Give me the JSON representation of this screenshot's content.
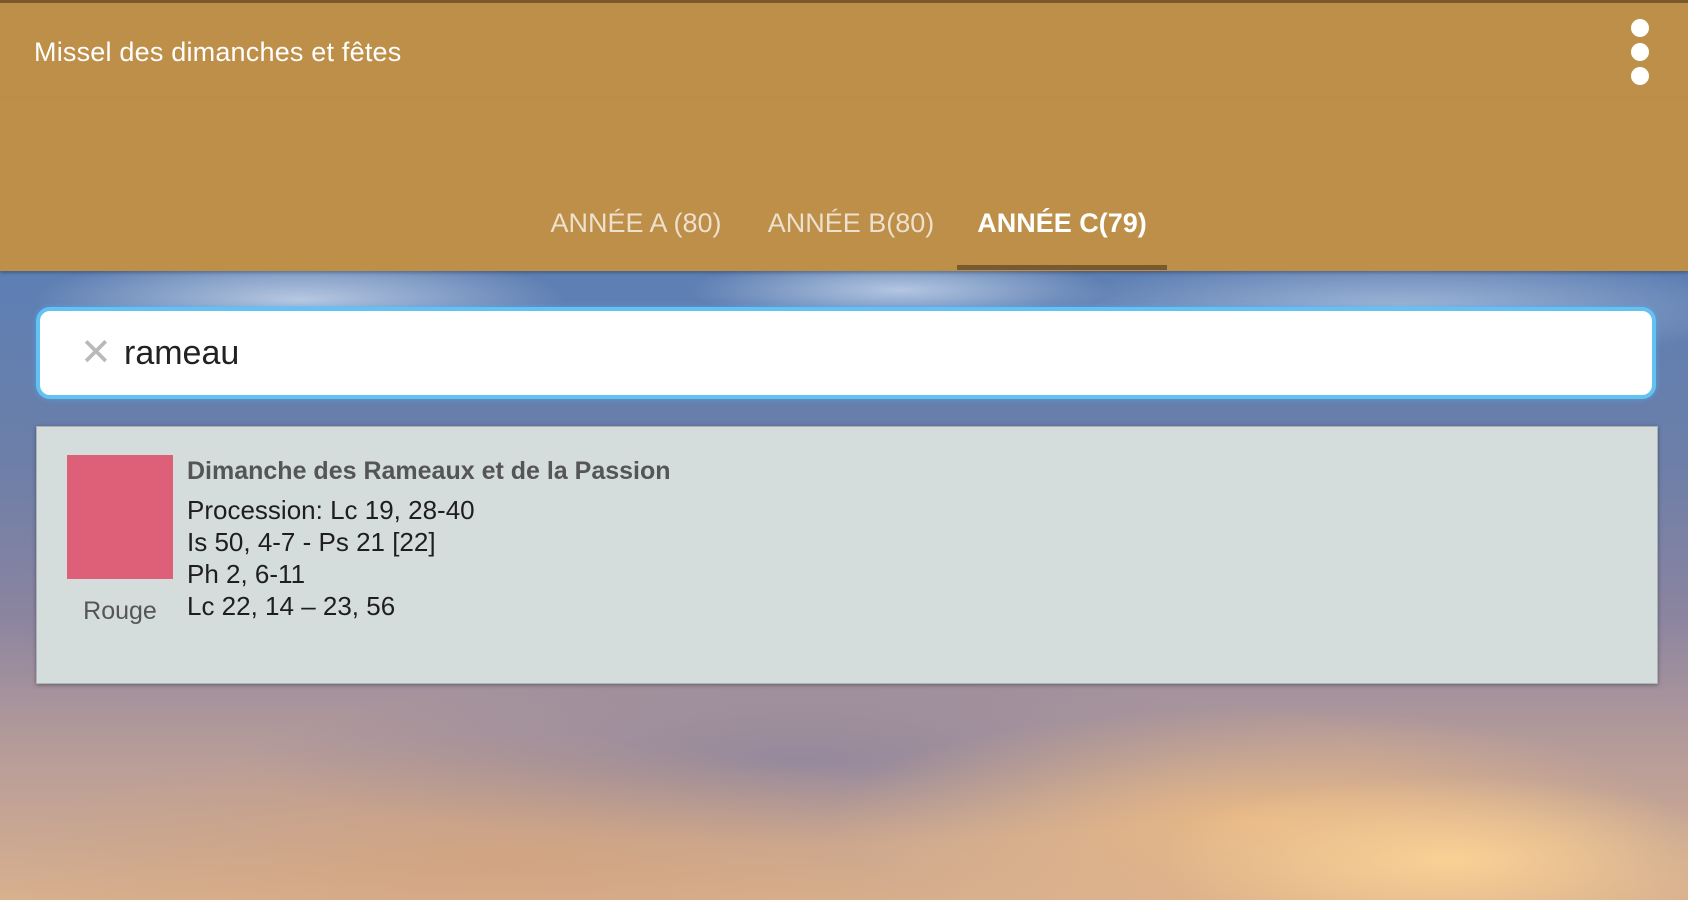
{
  "appbar": {
    "title": "Missel des dimanches et fêtes",
    "menu_icon": "more-vert-icon"
  },
  "tabs": [
    {
      "label": "ANNÉE A (80)",
      "active": false
    },
    {
      "label": "ANNÉE B(80)",
      "active": false
    },
    {
      "label": "ANNÉE C(79)",
      "active": true
    }
  ],
  "search": {
    "value": "rameau",
    "clear_icon": "close-icon"
  },
  "results": [
    {
      "title": "Dimanche des Rameaux et de la Passion",
      "color_name": "Rouge",
      "color_hex": "#dd6078",
      "readings": [
        "Procession: Lc 19, 28-40",
        "Is 50, 4-7 - Ps 21 [22]",
        "Ph 2, 6-11",
        "Lc 22, 14 – 23, 56"
      ]
    }
  ],
  "colors": {
    "primary": "#bd8f48",
    "primary_dark": "#7a5a2c",
    "search_focus": "#64c2f3",
    "card_bg": "#d5dcdc"
  }
}
